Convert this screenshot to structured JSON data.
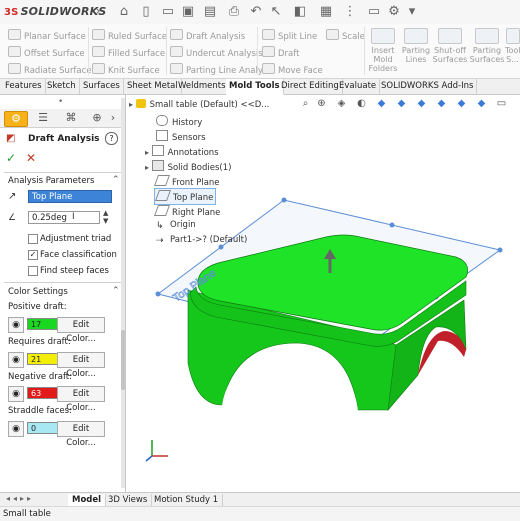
{
  "app": {
    "brand_prefix": "3S",
    "brand": "SOLIDWORKS"
  },
  "ribbon": {
    "col1": [
      "Planar Surface",
      "Offset Surface",
      "Radiate Surface"
    ],
    "col2": [
      "Ruled Surface",
      "Filled Surface",
      "Knit Surface"
    ],
    "col3": [
      "Draft Analysis",
      "Undercut Analysis",
      "Parting Line Analysis"
    ],
    "col4": [
      "Split Line",
      "Draft",
      "Move Face"
    ],
    "scale": "Scale",
    "big_buttons": [
      {
        "line1": "Insert",
        "line2": "Mold",
        "line3": "Folders"
      },
      {
        "line1": "Parting",
        "line2": "Lines",
        "line3": ""
      },
      {
        "line1": "Shut-off",
        "line2": "Surfaces",
        "line3": ""
      },
      {
        "line1": "Parting",
        "line2": "Surfaces",
        "line3": ""
      },
      {
        "line1": "Tool",
        "line2": "S...",
        "line3": ""
      }
    ]
  },
  "tabs": [
    "Features",
    "Sketch",
    "Surfaces",
    "Sheet Metal",
    "Weldments",
    "Mold Tools",
    "Direct Editing",
    "Evaluate",
    "SOLIDWORKS Add-Ins"
  ],
  "active_tab": "Mold Tools",
  "property_manager": {
    "title": "Draft Analysis",
    "help": "?",
    "analysis_parameters": {
      "heading": "Analysis Parameters",
      "direction_face": "Top Plane",
      "angle": "0.25deg",
      "options": [
        {
          "label": "Adjustment triad",
          "checked": false
        },
        {
          "label": "Face classification",
          "checked": true
        },
        {
          "label": "Find steep faces",
          "checked": false
        }
      ]
    },
    "color_settings": {
      "heading": "Color Settings",
      "rows": [
        {
          "label": "Positive draft:",
          "count": "17",
          "color": "#19d81f",
          "button": "Edit Color..."
        },
        {
          "label": "Requires draft:",
          "count": "21",
          "color": "#f2ee08",
          "button": "Edit Color..."
        },
        {
          "label": "Negative draft:",
          "count": "63",
          "color": "#e31a1a",
          "button": "Edit Color..."
        },
        {
          "label": "Straddle faces:",
          "count": "0",
          "color": "#a8e8f2",
          "button": "Edit Color..."
        }
      ]
    }
  },
  "tree": {
    "root": "Small table (Default) <<D...",
    "items": [
      "History",
      "Sensors",
      "Annotations",
      "Solid Bodies(1)",
      "Front Plane",
      "Top Plane",
      "Right Plane",
      "Origin",
      "Part1->? (Default)"
    ]
  },
  "viewport": {
    "plane_label": "Top Plane"
  },
  "bottom_tabs": [
    "Model",
    "3D Views",
    "Motion Study 1"
  ],
  "active_bottom_tab": "Model",
  "status": "Small table",
  "colors": {
    "accent_orange": "#f7b21a",
    "model_green": "#19d81f",
    "plane_blue": "#5b8fd6"
  }
}
